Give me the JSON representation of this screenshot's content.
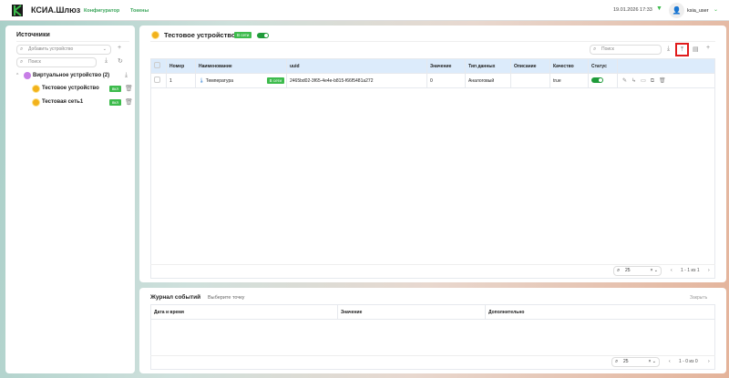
{
  "header": {
    "brand": "КСИА.Шлюз",
    "nav": [
      "Конфигуратор",
      "Токены"
    ],
    "datetime": "19.01.2026 17:33",
    "user": "ksia_user"
  },
  "sidebar": {
    "title": "Источники",
    "add_placeholder": "Добавить устройство",
    "search_placeholder": "Поиск",
    "group": {
      "label": "Виртуальное устройство (2)"
    },
    "items": [
      {
        "label": "Тестовое устройство",
        "badge": "вкл"
      },
      {
        "label": "Тестовая сеть1",
        "badge": "вкл"
      }
    ]
  },
  "device": {
    "title": "Тестовое устройство",
    "badge": "В сети",
    "search_placeholder": "Поиск",
    "columns": [
      "Номер",
      "Наименование",
      "uuid",
      "Значение",
      "Тип данных",
      "Описание",
      "Качество",
      "Статус"
    ],
    "rows": [
      {
        "num": "1",
        "name": "Температура",
        "badge": "В сети",
        "uuid": "2465bd02-3f65-4e4e-b815-f66f5481a272",
        "value": "0",
        "type": "Аналоговый",
        "desc": "",
        "quality": "true",
        "status": true
      }
    ],
    "page_size": "25",
    "pagination": "1 - 1 из 1"
  },
  "journal": {
    "title": "Журнал событий",
    "subtitle": "Выберите точку",
    "close": "Закрыть",
    "columns": [
      "Дата и время",
      "Значение",
      "Дополнительно"
    ],
    "page_size": "25",
    "pagination": "1 - 0 из 0"
  }
}
